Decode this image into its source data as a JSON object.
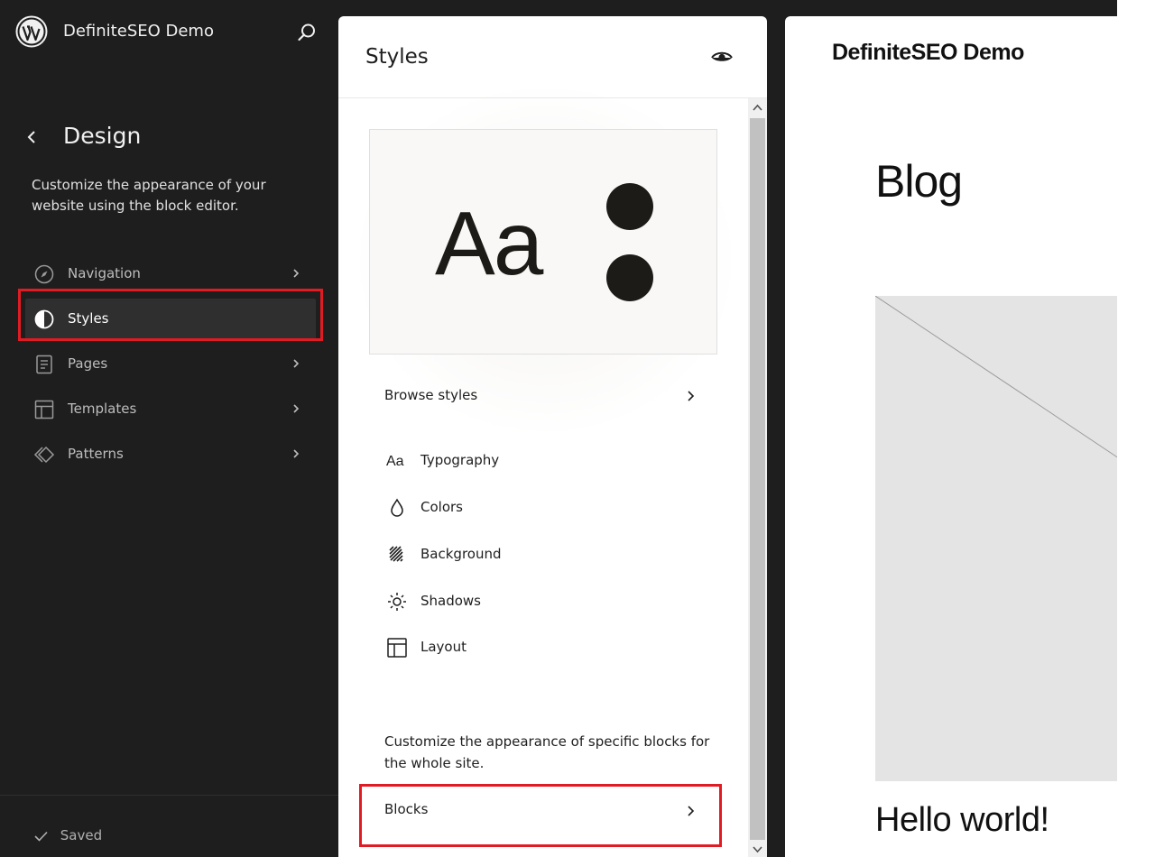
{
  "sidebar": {
    "site_title": "DefiniteSEO Demo",
    "section_title": "Design",
    "description": "Customize the appearance of your website using the block editor.",
    "items": [
      {
        "label": "Navigation",
        "icon": "compass-icon",
        "has_chevron": true,
        "active": false
      },
      {
        "label": "Styles",
        "icon": "half-circle-icon",
        "has_chevron": false,
        "active": true
      },
      {
        "label": "Pages",
        "icon": "page-icon",
        "has_chevron": true,
        "active": false
      },
      {
        "label": "Templates",
        "icon": "layout-icon",
        "has_chevron": true,
        "active": false
      },
      {
        "label": "Patterns",
        "icon": "symbol-icon",
        "has_chevron": true,
        "active": false
      }
    ],
    "status": "Saved"
  },
  "styles_panel": {
    "title": "Styles",
    "preview_text": "Aa",
    "browse_label": "Browse styles",
    "menu": [
      {
        "label": "Typography",
        "icon": "typography-icon"
      },
      {
        "label": "Colors",
        "icon": "droplet-icon"
      },
      {
        "label": "Background",
        "icon": "background-icon"
      },
      {
        "label": "Shadows",
        "icon": "shadow-icon"
      },
      {
        "label": "Layout",
        "icon": "layout-icon"
      }
    ],
    "blocks_description": "Customize the appearance of specific blocks for the whole site.",
    "blocks_label": "Blocks"
  },
  "site_preview": {
    "site_title": "DefiniteSEO Demo",
    "page_title": "Blog",
    "post_title": "Hello world!"
  },
  "colors": {
    "sidebar_bg": "#1e1e1e",
    "highlight": "#e01b24",
    "preview_dark": "#1c1b18"
  }
}
